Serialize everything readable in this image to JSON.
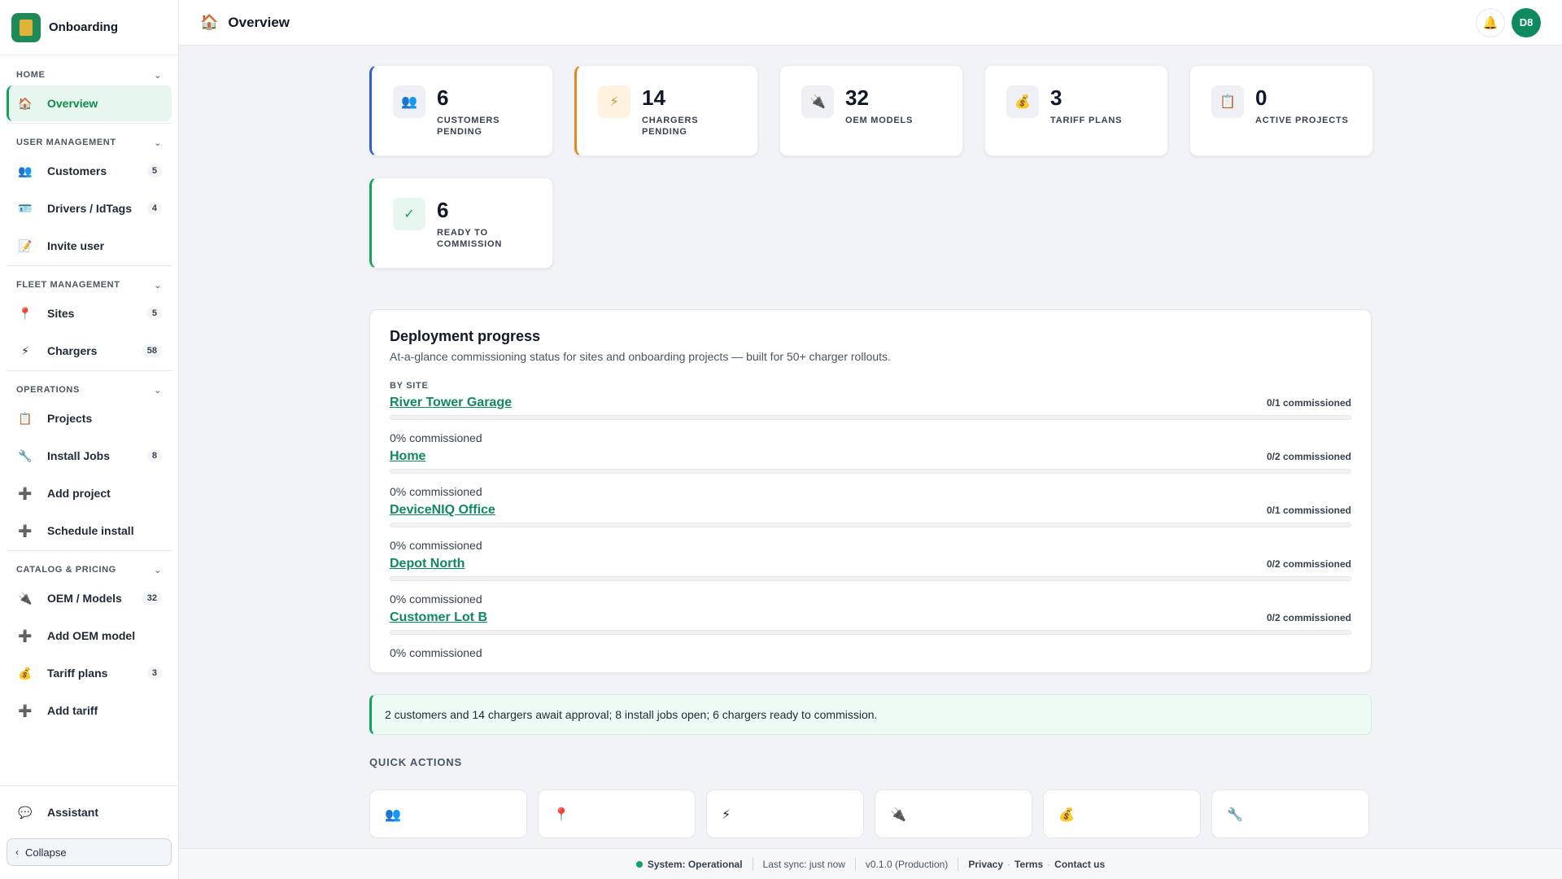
{
  "brand": {
    "name": "Onboarding"
  },
  "sidebar": {
    "sections": [
      {
        "title": "HOME",
        "items": [
          {
            "label": "Overview",
            "icon": "🏠",
            "badge": "",
            "active": true
          }
        ]
      },
      {
        "title": "USER MANAGEMENT",
        "items": [
          {
            "label": "Customers",
            "icon": "👥",
            "badge": "5"
          },
          {
            "label": "Drivers / IdTags",
            "icon": "🪪",
            "badge": "4"
          },
          {
            "label": "Invite user",
            "icon": "📝",
            "badge": ""
          }
        ]
      },
      {
        "title": "FLEET MANAGEMENT",
        "items": [
          {
            "label": "Sites",
            "icon": "📍",
            "badge": "5"
          },
          {
            "label": "Chargers",
            "icon": "⚡",
            "badge": "58"
          }
        ]
      },
      {
        "title": "OPERATIONS",
        "items": [
          {
            "label": "Projects",
            "icon": "📋",
            "badge": ""
          },
          {
            "label": "Install Jobs",
            "icon": "🔧",
            "badge": "8"
          },
          {
            "label": "Add project",
            "icon": "➕",
            "badge": ""
          },
          {
            "label": "Schedule install",
            "icon": "➕",
            "badge": ""
          }
        ]
      },
      {
        "title": "CATALOG & PRICING",
        "items": [
          {
            "label": "OEM / Models",
            "icon": "🔌",
            "badge": "32"
          },
          {
            "label": "Add OEM model",
            "icon": "➕",
            "badge": ""
          },
          {
            "label": "Tariff plans",
            "icon": "💰",
            "badge": "3"
          },
          {
            "label": "Add tariff",
            "icon": "➕",
            "badge": ""
          }
        ]
      }
    ],
    "assistant_label": "Assistant",
    "collapse_label": "Collapse"
  },
  "topbar": {
    "title": "Overview",
    "avatar_initials": "D8"
  },
  "stats": [
    {
      "value": "6",
      "label": "CUSTOMERS PENDING",
      "icon": "👥"
    },
    {
      "value": "14",
      "label": "CHARGERS PENDING",
      "icon": "⚡"
    },
    {
      "value": "32",
      "label": "OEM MODELS",
      "icon": "🔌"
    },
    {
      "value": "3",
      "label": "TARIFF PLANS",
      "icon": "💰"
    },
    {
      "value": "0",
      "label": "ACTIVE PROJECTS",
      "icon": "📋"
    },
    {
      "value": "6",
      "label": "READY TO COMMISSION",
      "icon": "✓"
    }
  ],
  "deployment": {
    "title": "Deployment progress",
    "subtitle": "At-a-glance commissioning status for sites and onboarding projects — built for 50+ charger rollouts.",
    "by_site_label": "BY SITE",
    "sites": [
      {
        "name": "River Tower Garage",
        "count": "0/1 commissioned",
        "pct_text": "0% commissioned",
        "progress": 0
      },
      {
        "name": "Home",
        "count": "0/2 commissioned",
        "pct_text": "0% commissioned",
        "progress": 0
      },
      {
        "name": "DeviceNIQ Office",
        "count": "0/1 commissioned",
        "pct_text": "0% commissioned",
        "progress": 0
      },
      {
        "name": "Depot North",
        "count": "0/2 commissioned",
        "pct_text": "0% commissioned",
        "progress": 0
      },
      {
        "name": "Customer Lot B",
        "count": "0/2 commissioned",
        "pct_text": "0% commissioned",
        "progress": 0
      }
    ]
  },
  "summary": "2 customers and 14 chargers await approval; 8 install jobs open; 6 chargers ready to commission.",
  "quick_actions": {
    "title": "QUICK ACTIONS",
    "icons": [
      "👥",
      "📍",
      "⚡",
      "🔌",
      "💰",
      "🔧"
    ]
  },
  "footer": {
    "status": "System: Operational",
    "last_sync": "Last sync: just now",
    "version": "v0.1.0 (Production)",
    "privacy": "Privacy",
    "terms": "Terms",
    "contact": "Contact us"
  },
  "colors": {
    "accent": "#10a35e",
    "brand": "#1f8a55",
    "blue": "#2e5fcf",
    "orange": "#e08a1e"
  }
}
